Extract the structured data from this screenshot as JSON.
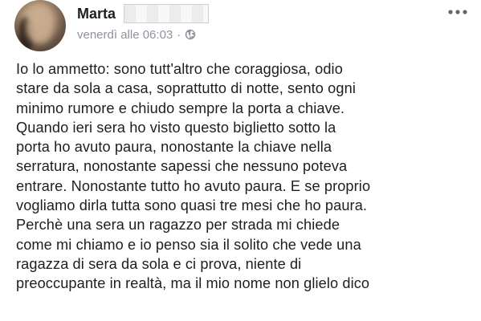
{
  "post": {
    "author": {
      "name": "Marta"
    },
    "meta": {
      "timestamp": "venerdì alle 06:03",
      "separator": "·",
      "audience_icon": "globe-icon"
    },
    "more_icon": "ellipsis-icon",
    "body_lines": [
      "Io lo ammetto: sono tutt'altro che coraggiosa, odio",
      "stare da sola a casa, soprattutto di notte, sento ogni",
      "minimo rumore e chiudo sempre la porta a chiave.",
      "Quando ieri sera ho visto questo biglietto sotto la",
      "porta ho avuto paura, nonostante la chiave nella",
      "serratura, nonostante sapessi che nessuno poteva",
      "entrare. Nonostante tutto ho avuto paura. E se proprio",
      "vogliamo dirla tutta sono quasi tre mesi che ho paura.",
      "Perchè una sera un ragazzo per strada mi chiede",
      "come mi chiamo e io penso sia il solito che vede una",
      "ragazza di sera da sola e ci prova, niente di",
      "preoccupante in realtà, ma il mio nome non glielo dico"
    ],
    "colors": {
      "text": "#1c1e21",
      "meta": "#8d949e",
      "background": "#ffffff"
    }
  }
}
